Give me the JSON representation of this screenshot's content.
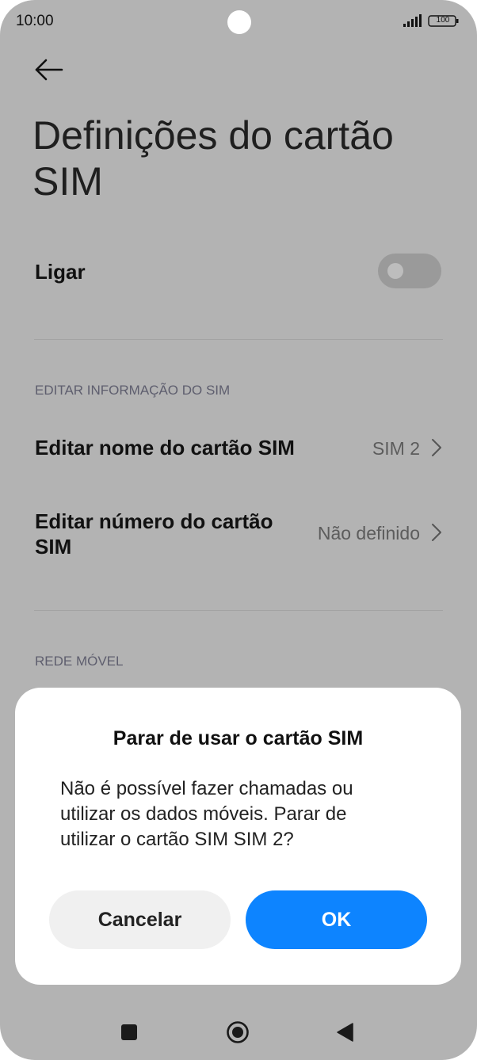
{
  "status_bar": {
    "time": "10:00",
    "battery": "100",
    "signal_icon": "signal-bars-icon",
    "battery_icon": "battery-icon"
  },
  "header": {
    "back_icon": "arrow-left-icon",
    "title_line1": "Definições do cartão",
    "title_line2": "SIM"
  },
  "settings": {
    "power_row": {
      "label": "Ligar",
      "toggle_on": false
    },
    "section_edit": "EDITAR INFORMAÇÃO DO SIM",
    "edit_name": {
      "label": "Editar nome do cartão SIM",
      "value": "SIM 2"
    },
    "edit_number": {
      "label_line1": "Editar número do cartão",
      "label_line2": "SIM",
      "value": "Não definido"
    },
    "section_network": "REDE MÓVEL"
  },
  "dialog": {
    "title": "Parar de usar o cartão SIM",
    "message_line1": "Não é possível fazer chamadas ou",
    "message_line2": "utilizar os dados móveis. Parar de",
    "message_line3": "utilizar o cartão SIM SIM 2?",
    "cancel_label": "Cancelar",
    "ok_label": "OK"
  },
  "navigation": {
    "recents_icon": "square-icon",
    "home_icon": "circle-home-icon",
    "back_icon": "triangle-back-icon"
  },
  "colors": {
    "overlay_background": "#b3b3b3",
    "accent": "#0d84ff",
    "dialog_background": "#ffffff"
  }
}
